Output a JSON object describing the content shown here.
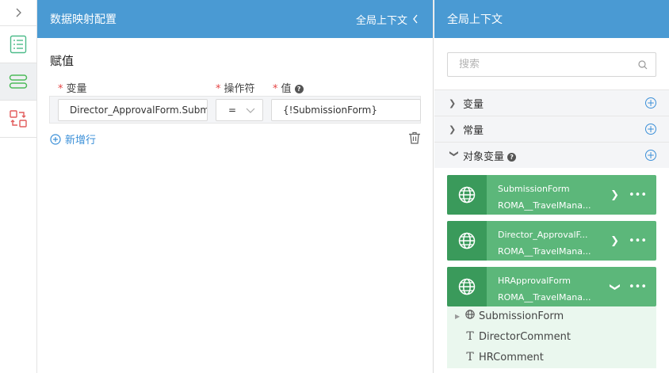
{
  "center": {
    "header_title": "数据映射配置",
    "context_toggle": "全局上下文",
    "section_title": "赋值",
    "columns": {
      "variable": "变量",
      "operator": "操作符",
      "value": "值"
    },
    "row": {
      "variable": "Director_ApprovalForm.SubmissionForm",
      "operator": "=",
      "value": "{!SubmissionForm}"
    },
    "add_row": "新增行"
  },
  "right": {
    "header_title": "全局上下文",
    "search_placeholder": "搜索",
    "groups": [
      {
        "label": "变量",
        "expanded": false
      },
      {
        "label": "常量",
        "expanded": false
      },
      {
        "label": "对象变量",
        "expanded": true
      }
    ],
    "objects": [
      {
        "name": "SubmissionForm",
        "type": "ROMA__TravelMana...",
        "expanded": false
      },
      {
        "name": "Director_ApprovalF...",
        "type": "ROMA__TravelMana...",
        "expanded": false
      },
      {
        "name": "HRApprovalForm",
        "type": "ROMA__TravelMana...",
        "expanded": true
      }
    ],
    "children": [
      {
        "label": "SubmissionForm",
        "icon": "globe-icon"
      },
      {
        "label": "DirectorComment",
        "icon": "text-type-icon"
      },
      {
        "label": "HRComment",
        "icon": "text-type-icon"
      }
    ]
  },
  "colors": {
    "header_blue": "#4a9ad3",
    "card_green": "#5cb77a",
    "card_icon_green": "#3a9a5b",
    "link_blue": "#3a8fd8",
    "required_red": "#e54545"
  }
}
